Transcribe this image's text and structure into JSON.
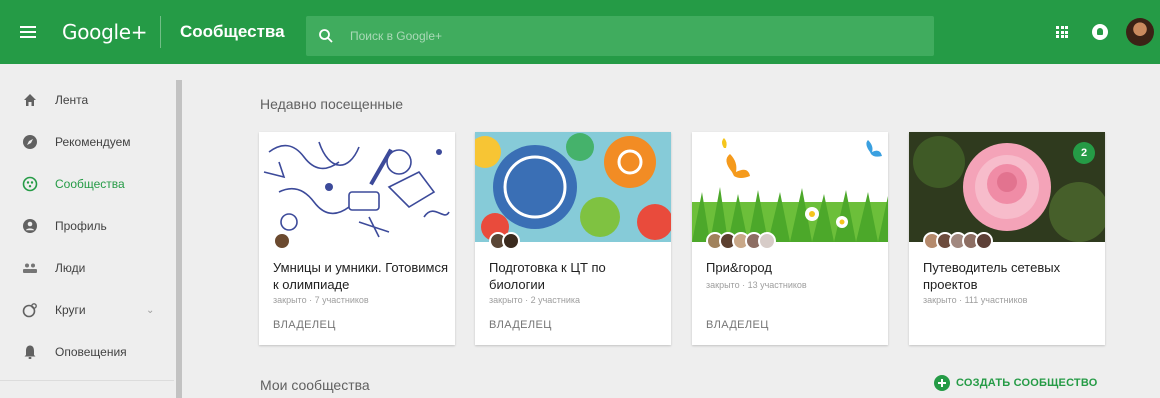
{
  "header": {
    "brand": "Google+",
    "section_title": "Сообщества",
    "search_placeholder": "Поиск в Google+",
    "accent_color": "#259b46"
  },
  "sidebar": {
    "items": [
      {
        "label": "Лента",
        "icon": "home-icon"
      },
      {
        "label": "Рекомендуем",
        "icon": "compass-icon"
      },
      {
        "label": "Сообщества",
        "icon": "communities-icon",
        "active": true
      },
      {
        "label": "Профиль",
        "icon": "profile-icon"
      },
      {
        "label": "Люди",
        "icon": "people-icon"
      },
      {
        "label": "Круги",
        "icon": "circles-icon",
        "caret": "⌄"
      },
      {
        "label": "Оповещения",
        "icon": "bell-icon"
      }
    ]
  },
  "main": {
    "recent_heading": "Недавно посещенные",
    "my_heading": "Мои сообщества",
    "create_label": "СОЗДАТЬ СООБЩЕСТВО",
    "cards": [
      {
        "title": "Умницы и умники. Готовимся к олимпиаде",
        "meta": "закрыто · 7 участников",
        "role": "ВЛАДЕЛЕЦ"
      },
      {
        "title": "Подготовка к ЦТ по биологии",
        "meta": "закрыто · 2 участника",
        "role": "ВЛАДЕЛЕЦ"
      },
      {
        "title": "При&город",
        "meta": "закрыто · 13 участников",
        "role": "ВЛАДЕЛЕЦ"
      },
      {
        "title": "Путеводитель сетевых проектов",
        "meta": "закрыто · 111 участников",
        "badge": "2"
      }
    ]
  }
}
